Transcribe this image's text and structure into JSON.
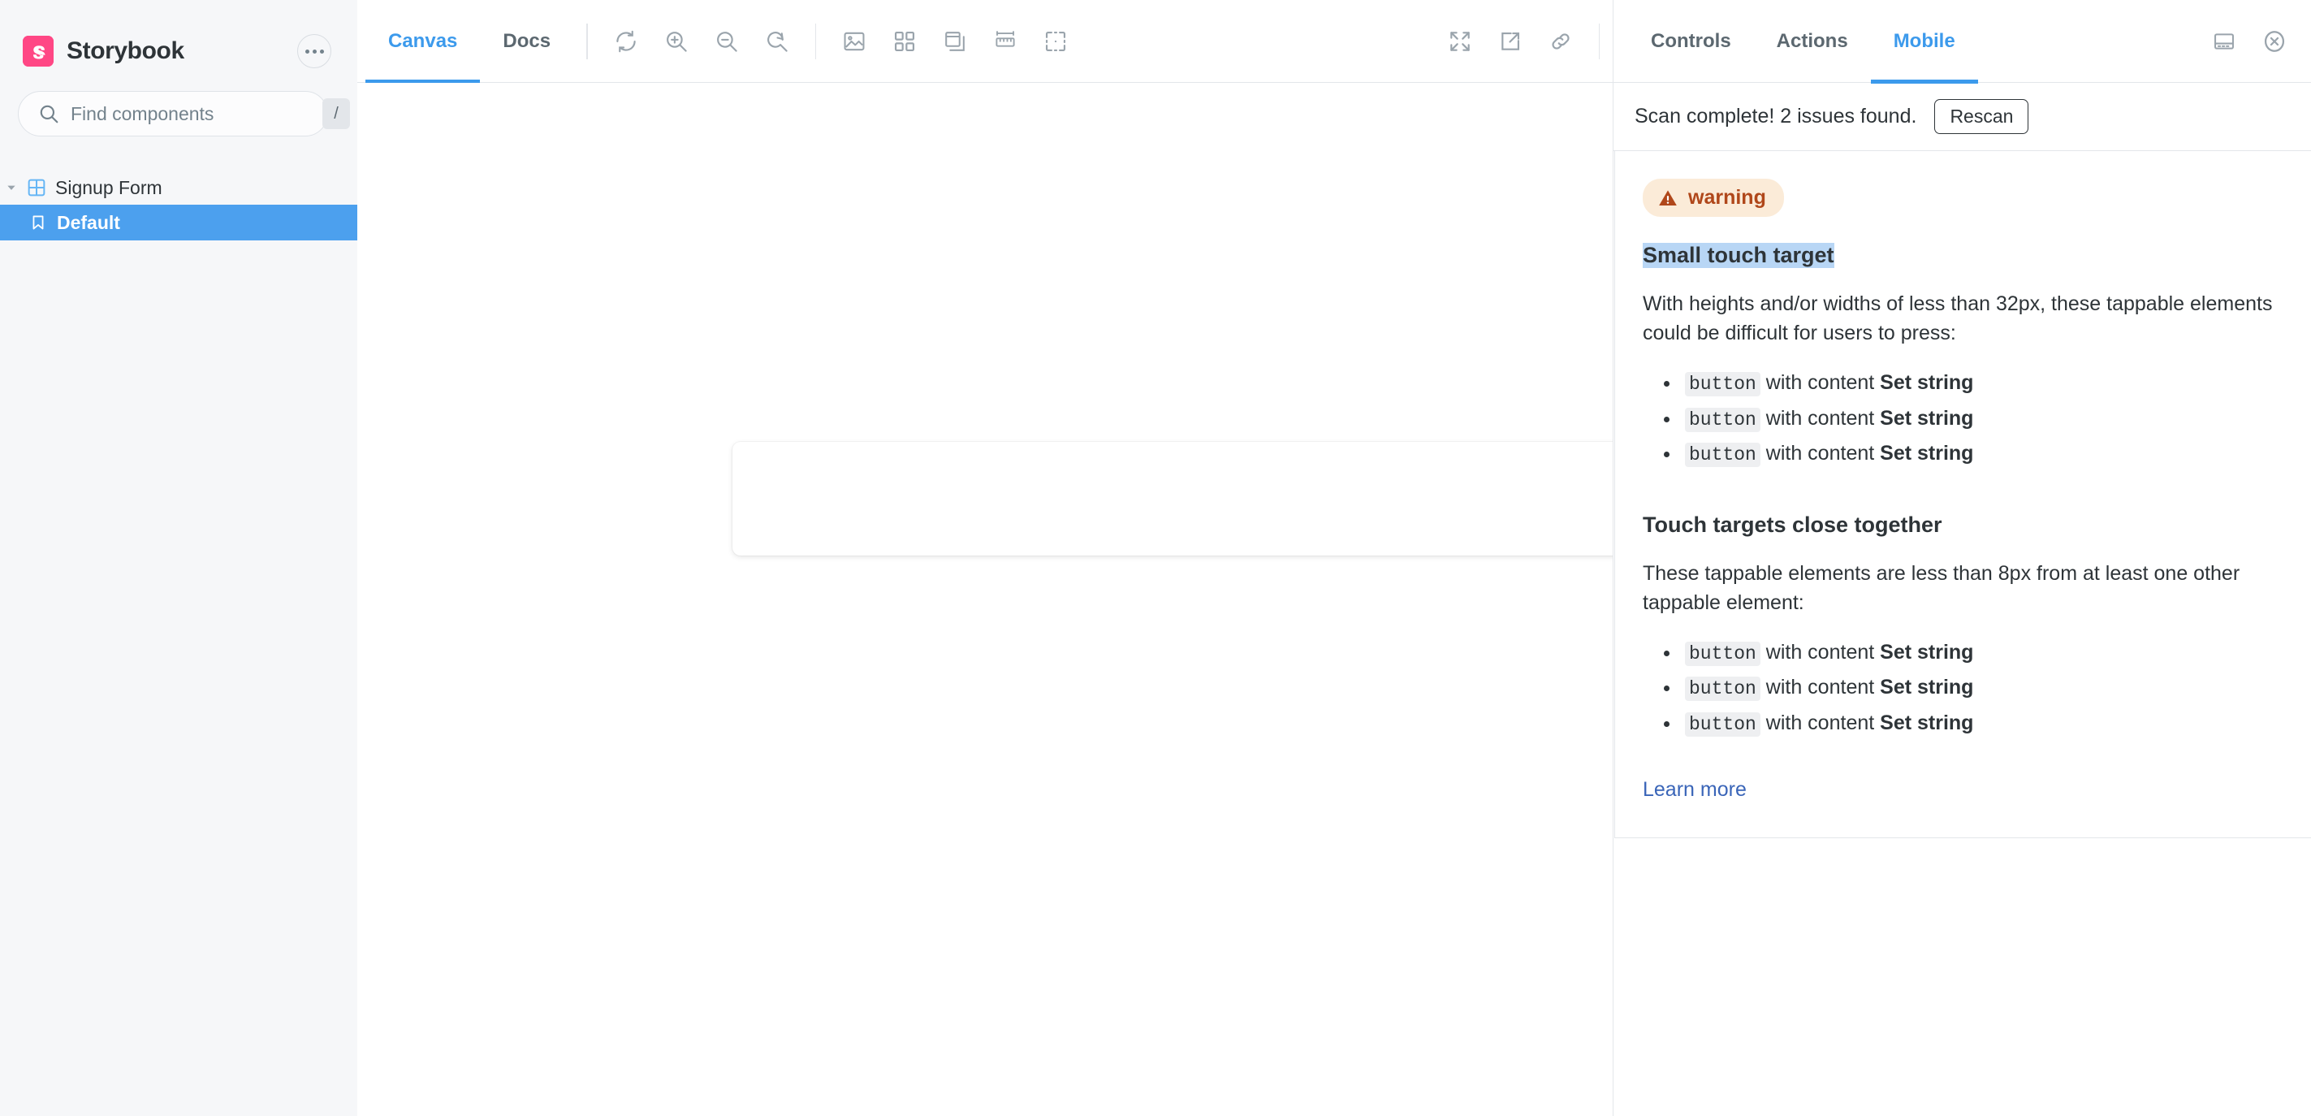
{
  "sidebar": {
    "brand_name": "Storybook",
    "logo_icon": "storybook-logo",
    "menu_icon": "more-options-icon",
    "search": {
      "placeholder": "Find components",
      "value": "",
      "icon": "search-icon",
      "shortcut": "/"
    },
    "tree": [
      {
        "label": "Signup Form",
        "icon": "component-grid-icon",
        "chevron": "chevron-down-icon",
        "type": "component",
        "selected": false
      },
      {
        "label": "Default",
        "icon": "bookmark-icon",
        "type": "story",
        "selected": true
      }
    ]
  },
  "toolbar": {
    "tabs": [
      {
        "label": "Canvas",
        "active": true
      },
      {
        "label": "Docs",
        "active": false
      }
    ],
    "left_icons": [
      {
        "name": "remount-icon",
        "title": "Remount component"
      },
      {
        "name": "zoom-in-icon",
        "title": "Zoom in"
      },
      {
        "name": "zoom-out-icon",
        "title": "Zoom out"
      },
      {
        "name": "zoom-reset-icon",
        "title": "Reset zoom"
      }
    ],
    "addon_icons": [
      {
        "name": "backgrounds-image-icon",
        "title": "Change background"
      },
      {
        "name": "grid-icon",
        "title": "Apply a grid to the preview"
      },
      {
        "name": "viewport-icon",
        "title": "Change the size of the preview"
      },
      {
        "name": "measure-ruler-icon",
        "title": "Enable measure"
      },
      {
        "name": "outline-icon",
        "title": "Apply outlines to the preview"
      }
    ],
    "right_icons": [
      {
        "name": "fullscreen-icon",
        "title": "Go full screen"
      },
      {
        "name": "open-new-tab-icon",
        "title": "Open canvas in new tab"
      },
      {
        "name": "copy-link-icon",
        "title": "Copy canvas link"
      }
    ]
  },
  "panel": {
    "tabs": [
      {
        "label": "Controls",
        "active": false
      },
      {
        "label": "Actions",
        "active": false
      },
      {
        "label": "Mobile",
        "active": true
      }
    ],
    "position_icon": "panel-position-icon",
    "close_icon": "close-circle-icon",
    "scan": {
      "status_text": "Scan complete! 2 issues found.",
      "rescan_label": "Rescan"
    },
    "issue": {
      "severity_label": "warning",
      "severity_icon": "warning-triangle-icon",
      "title": "Small touch target",
      "title_selected": true,
      "description": "With heights and/or widths of less than 32px, these tappable elements could be difficult for users to press:",
      "items": [
        {
          "tag": "button",
          "middle": "with content",
          "content": "Set string"
        },
        {
          "tag": "button",
          "middle": "with content",
          "content": "Set string"
        },
        {
          "tag": "button",
          "middle": "with content",
          "content": "Set string"
        }
      ],
      "section2_title": "Touch targets close together",
      "section2_description": "These tappable elements are less than 8px from at least one other tappable element:",
      "section2_items": [
        {
          "tag": "button",
          "middle": "with content",
          "content": "Set string"
        },
        {
          "tag": "button",
          "middle": "with content",
          "content": "Set string"
        },
        {
          "tag": "button",
          "middle": "with content",
          "content": "Set string"
        }
      ],
      "learn_more_label": "Learn more"
    }
  },
  "colors": {
    "brand_pink": "#FF4785",
    "accent_blue": "#3C9AEC",
    "selected_row_blue": "#4CA0EE",
    "warning_bg": "#FBEBD8",
    "warning_fg": "#B0471A",
    "selection_highlight": "#B8D6F5",
    "link_blue": "#3A65B8",
    "sidebar_bg": "#F6F7F9",
    "border_gray": "#E3E6EA"
  }
}
